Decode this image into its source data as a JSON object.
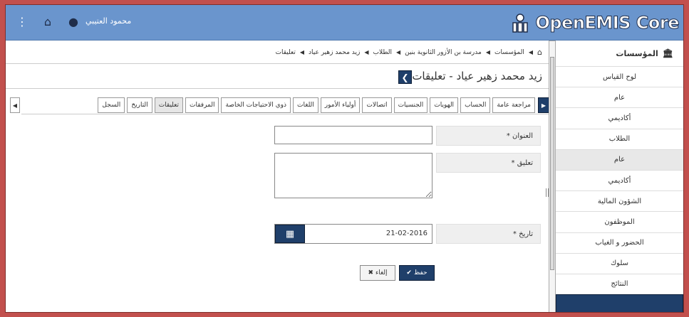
{
  "topbar": {
    "menu_icon": "ellipsis-vertical-icon",
    "home_icon": "home-icon",
    "user_icon": "user-icon",
    "user_name": "محمود العتيبي",
    "brand": "OpenEMIS Core"
  },
  "breadcrumb": {
    "home_icon": "home-icon",
    "items": [
      "المؤسسات",
      "مدرسة بن الأزور الثانوية بنين",
      "الطلاب",
      "زيد محمد زهير عياد",
      "تعليقات"
    ]
  },
  "page": {
    "title": "زيد محمد زهير عياد - تعليقات"
  },
  "tabs": [
    {
      "label": "مراجعة عامة",
      "active": false
    },
    {
      "label": "الحساب",
      "active": false
    },
    {
      "label": "الهويات",
      "active": false
    },
    {
      "label": "الجنسيات",
      "active": false
    },
    {
      "label": "اتصالات",
      "active": false
    },
    {
      "label": "أولياء الأمور",
      "active": false
    },
    {
      "label": "اللغات",
      "active": false
    },
    {
      "label": "ذوي الاحتياجات الخاصة",
      "active": false
    },
    {
      "label": "المرفقات",
      "active": false
    },
    {
      "label": "تعليقات",
      "active": true
    },
    {
      "label": "التاريخ",
      "active": false
    },
    {
      "label": "السجل",
      "active": false
    }
  ],
  "form": {
    "title_label": "* العنوان",
    "title_value": "",
    "comment_label": "* تعليق",
    "comment_value": "",
    "date_label": "* تاريخ",
    "date_value": "21-02-2016",
    "save_label": "حفظ",
    "cancel_label": "إلغاء"
  },
  "sidebar": {
    "header": "المؤسسات",
    "items": [
      {
        "label": "لوح القياس",
        "state": "normal"
      },
      {
        "label": "عام",
        "state": "normal"
      },
      {
        "label": "أكاديمي",
        "state": "normal"
      },
      {
        "label": "الطلاب",
        "state": "normal"
      },
      {
        "label": "عام",
        "state": "highlight"
      },
      {
        "label": "أكاديمي",
        "state": "normal"
      },
      {
        "label": "الشؤون المالية",
        "state": "normal"
      },
      {
        "label": "الموظفون",
        "state": "normal"
      },
      {
        "label": "الحضور و الغياب",
        "state": "normal"
      },
      {
        "label": "سلوك",
        "state": "normal"
      },
      {
        "label": "النتائج",
        "state": "normal"
      },
      {
        "label": "",
        "state": "active"
      }
    ]
  },
  "colors": {
    "topbar": "#6a95cd",
    "accent": "#1f3f6a",
    "frame": "#c2504d"
  }
}
